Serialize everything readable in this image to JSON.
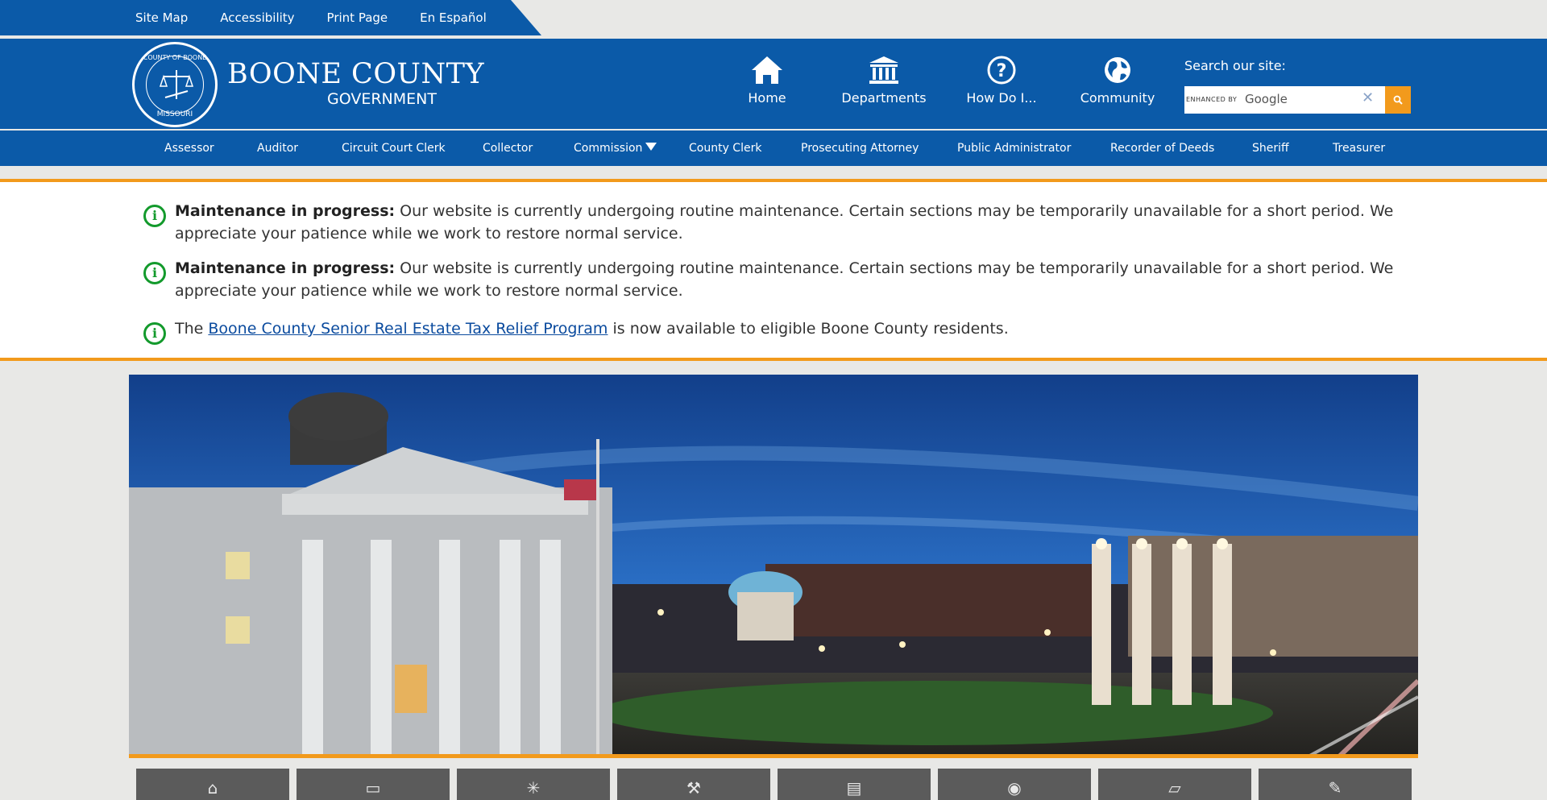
{
  "utility": {
    "links": [
      "Site Map",
      "Accessibility",
      "Print Page",
      "En Español"
    ]
  },
  "brand": {
    "title": "BOONE COUNTY",
    "subtitle": "GOVERNMENT",
    "seal_top": "COUNTY OF BOONE",
    "seal_bottom": "MISSOURI"
  },
  "quick_links": [
    {
      "label": "Home",
      "icon": "home-icon"
    },
    {
      "label": "Departments",
      "icon": "building-icon"
    },
    {
      "label": "How Do I...",
      "icon": "question-icon"
    },
    {
      "label": "Community",
      "icon": "globe-icon"
    }
  ],
  "search": {
    "label": "Search our site:",
    "enhanced_by": "ENHANCED BY",
    "provider": "Google",
    "clear_glyph": "✕"
  },
  "departments": [
    "Assessor",
    "Auditor",
    "Circuit Court Clerk",
    "Collector",
    "Commission",
    "County Clerk",
    "Prosecuting Attorney",
    "Public Administrator",
    "Recorder of Deeds",
    "Sheriff",
    "Treasurer"
  ],
  "alerts": [
    {
      "bold": "Maintenance in progress:",
      "text": " Our website is currently undergoing routine maintenance. Certain sections may be temporarily unavailable for a short period. We appreciate your patience while we work to restore normal service."
    },
    {
      "bold": "Maintenance in progress:",
      "text": " Our website is currently undergoing routine maintenance. Certain sections may be temporarily unavailable for a short period. We appreciate your patience while we work to restore normal service."
    },
    {
      "prefix": "The ",
      "link": "Boone County Senior Real Estate Tax Relief Program",
      "suffix": " is now available to eligible Boone County residents."
    }
  ],
  "tiles": [
    "home-bike-icon",
    "tax-icon",
    "light-icon",
    "gavel-icon",
    "documents-icon",
    "map-pin-icon",
    "notice-icon",
    "feather-icon"
  ],
  "colors": {
    "brand_blue": "#0b5aa8",
    "accent_orange": "#f29a1c",
    "info_green": "#139a2c"
  }
}
